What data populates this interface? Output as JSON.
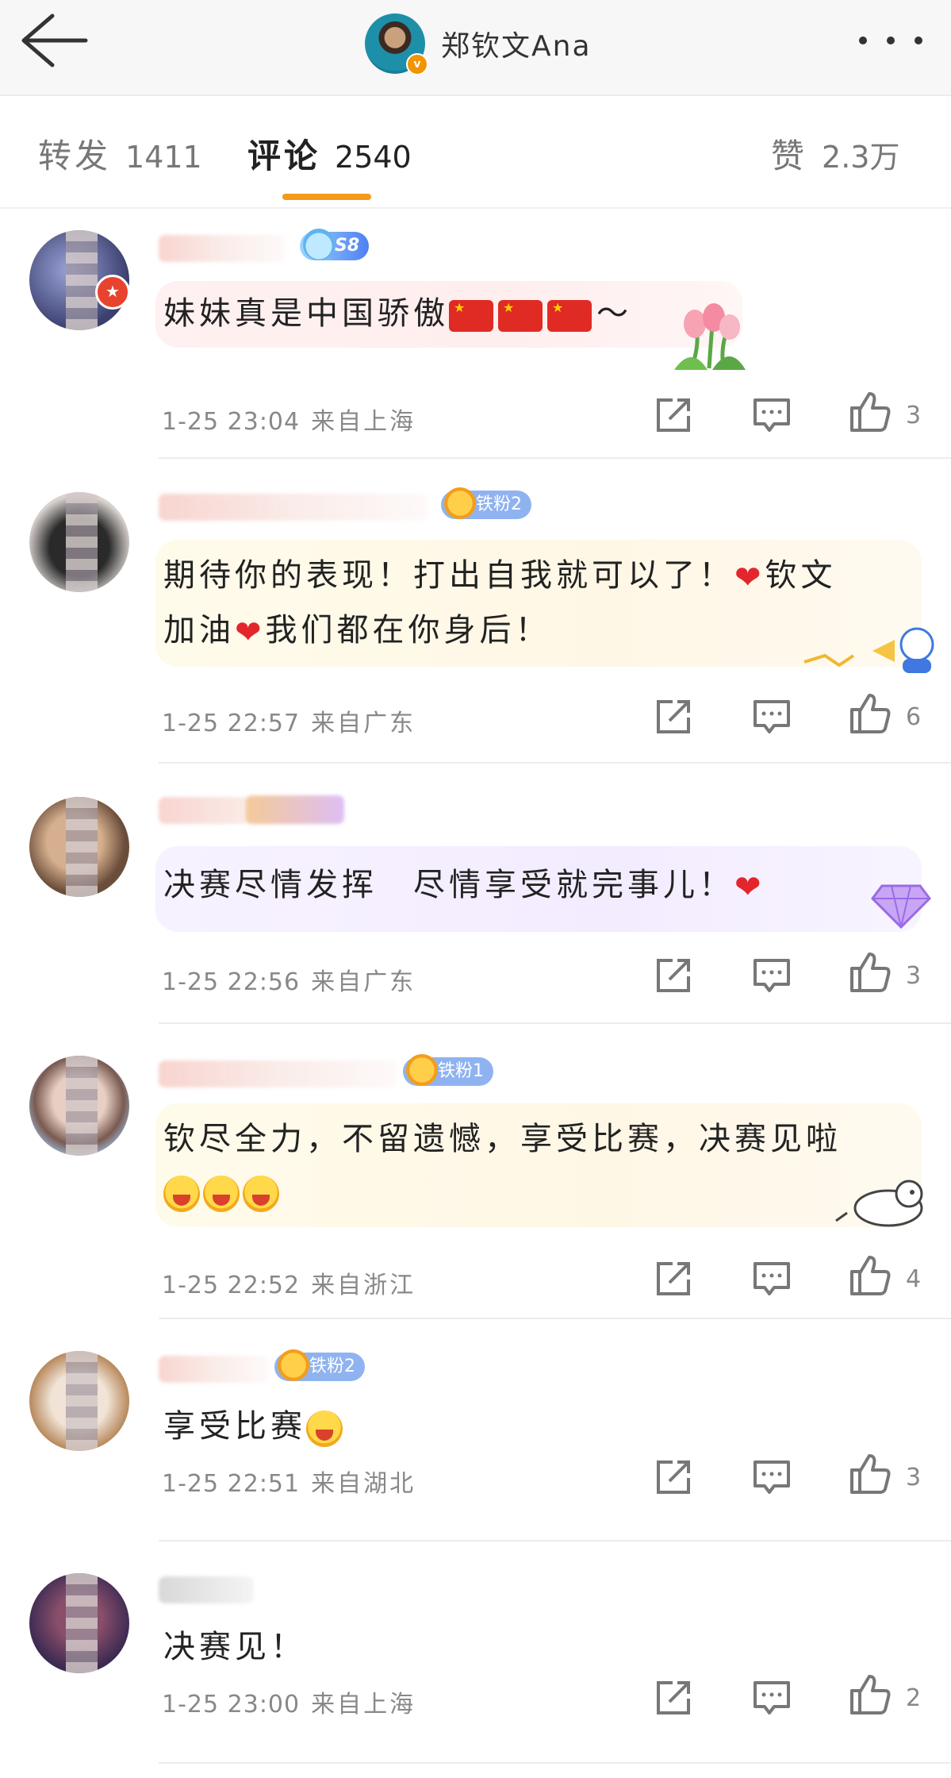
{
  "header": {
    "back_label": "back",
    "title": "郑钦文Ana",
    "verified": "v"
  },
  "tabs": [
    {
      "label": "转发",
      "count": "1411"
    },
    {
      "label": "评论",
      "count": "2540"
    },
    {
      "label": "赞",
      "count": "2.3万"
    }
  ],
  "comments": [
    {
      "text": "妹妹真是中国骄傲",
      "tail": "～",
      "badge": "S8",
      "date": "1-25",
      "time": "23:04",
      "location": "来自上海",
      "likes": "3"
    },
    {
      "text_a": "期待你的表现！打出自我就可以了！",
      "text_b": "钦文",
      "text_c": "加油",
      "text_d": "我们都在你身后！",
      "badge": "铁粉2",
      "date": "1-25",
      "time": "22:57",
      "location": "来自广东",
      "likes": "6"
    },
    {
      "text": "决赛尽情发挥　尽情享受就完事儿！",
      "date": "1-25",
      "time": "22:56",
      "location": "来自广东",
      "likes": "3"
    },
    {
      "text": "钦尽全力，不留遗憾，享受比赛，决赛见啦",
      "badge": "铁粉1",
      "date": "1-25",
      "time": "22:52",
      "location": "来自浙江",
      "likes": "4"
    },
    {
      "text": "享受比赛",
      "badge": "铁粉2",
      "date": "1-25",
      "time": "22:51",
      "location": "来自湖北",
      "likes": "3"
    },
    {
      "text": "决赛见！",
      "date": "1-25",
      "time": "23:00",
      "location": "来自上海",
      "likes": "2"
    }
  ],
  "icons": {
    "repost": "repost-icon",
    "comment": "comment-icon",
    "like": "thumbs-up-icon"
  },
  "colors": {
    "accent": "#f39a1b",
    "verified": "#f29400",
    "heart": "#e3262c"
  }
}
